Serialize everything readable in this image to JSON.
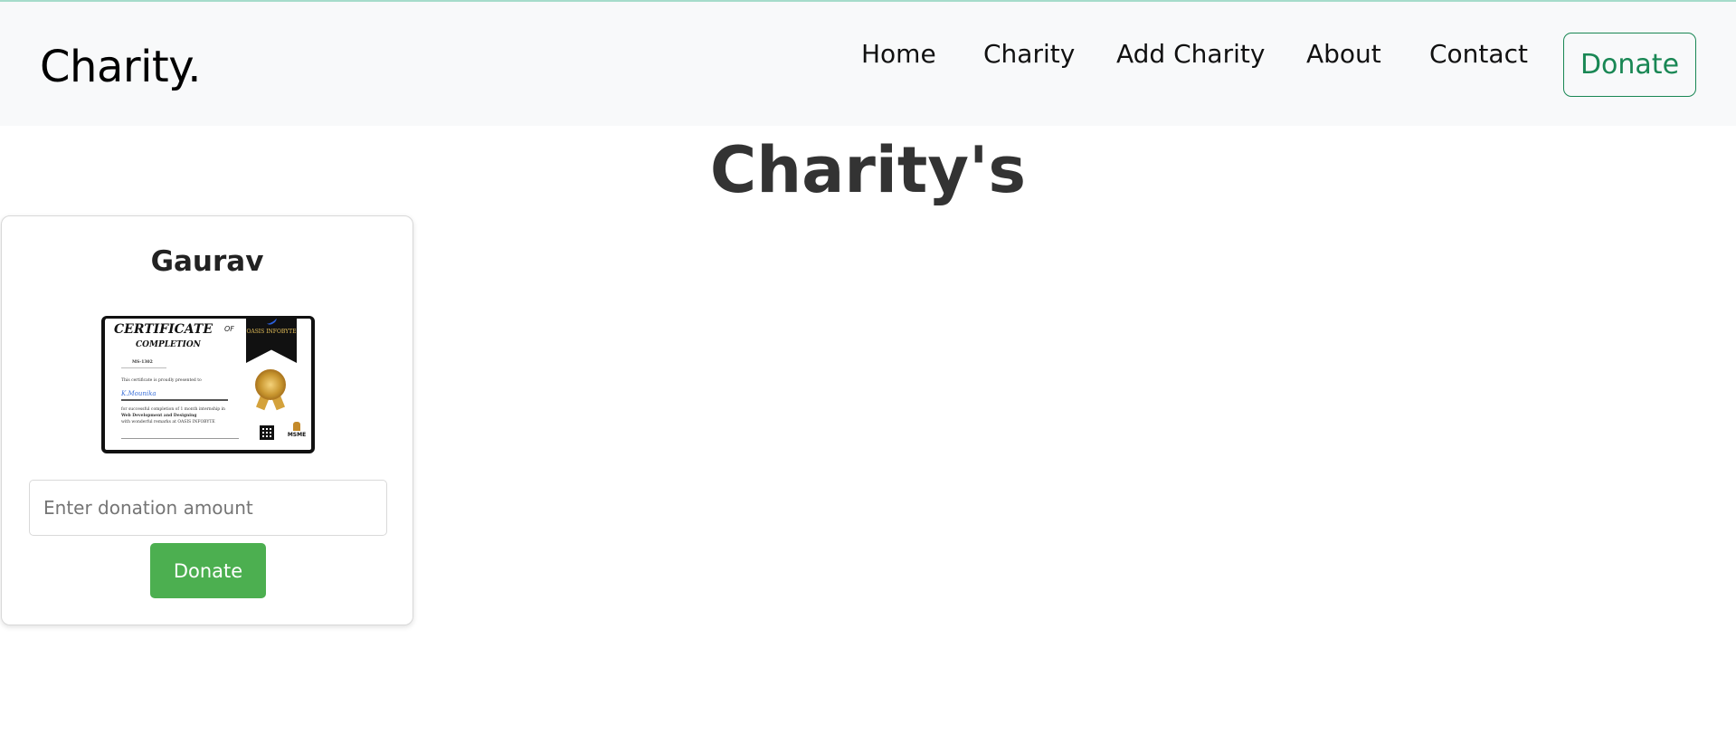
{
  "navbar": {
    "brand": "Charity.",
    "links": [
      "Home",
      "Charity",
      "Add Charity",
      "About",
      "Contact"
    ],
    "donate_label": "Donate"
  },
  "page": {
    "title": "Charity's"
  },
  "cards": [
    {
      "name": "Gaurav",
      "image": {
        "title": "CERTIFICATE",
        "of": "OF",
        "subtitle": "COMPLETION",
        "ribbon": "OASIS INFOBYTE",
        "id_text": "MS-1302",
        "presented_text": "This certificate is proudly presented to",
        "recipient": "K.Mounika",
        "body_line1": "for successful completion of 1 month internship in",
        "body_line2": "Web Development and Designing",
        "body_line3": "with wonderful remarks at OASIS INFOBYTE",
        "emblem_text": "MSME"
      },
      "amount_placeholder": "Enter donation amount",
      "donate_label": "Donate"
    }
  ]
}
